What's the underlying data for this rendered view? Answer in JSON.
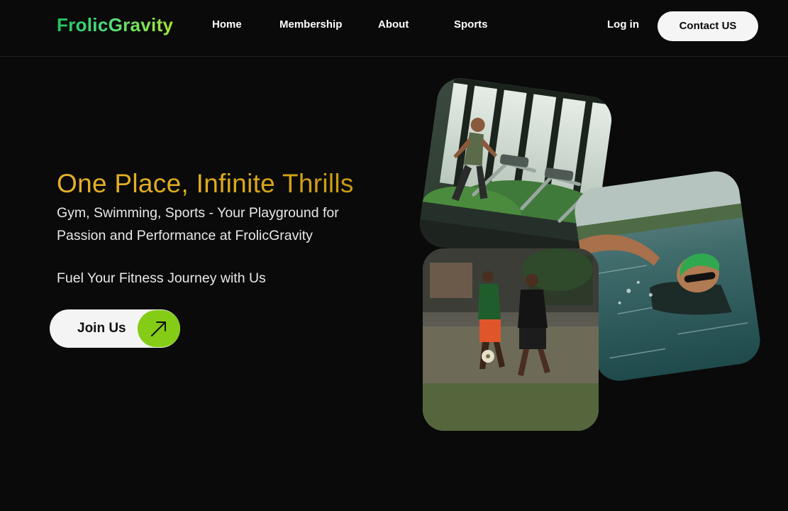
{
  "nav": {
    "logo": "FrolicGravity",
    "links": [
      {
        "label": "Home"
      },
      {
        "label": "Membership"
      },
      {
        "label": "About"
      },
      {
        "label": "Sports"
      }
    ],
    "login_label": "Log in",
    "contact_label": "Contact US"
  },
  "hero": {
    "title": "One Place, Infinite Thrills",
    "subtitle": "Gym, Swimming, Sports - Your Playground for Passion and Performance at  FrolicGravity",
    "tagline": "Fuel Your Fitness Journey with Us",
    "cta_label": "Join Us",
    "cta_icon": "arrow-up-right-icon"
  },
  "colors": {
    "background": "#0a0a0a",
    "logo_green": "#4ade80",
    "title_gold": "#ddaa1c",
    "cta_accent": "#84cc16",
    "button_light": "#f4f4f4"
  }
}
